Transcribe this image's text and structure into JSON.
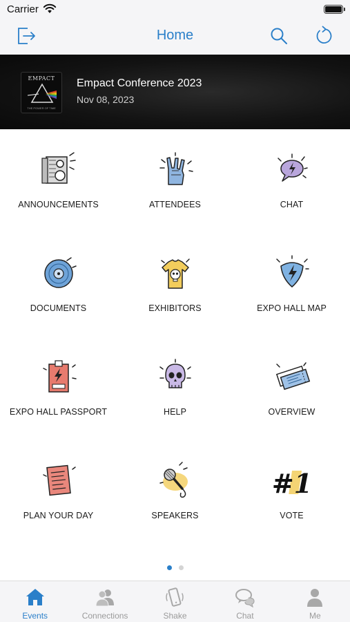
{
  "status_bar": {
    "carrier": "Carrier"
  },
  "nav": {
    "title": "Home"
  },
  "event": {
    "logo_text": "EMPACT",
    "logo_tagline": "THE POWER OF TIME",
    "title": "Empact Conference 2023",
    "date": "Nov 08, 2023"
  },
  "grid": {
    "items": [
      {
        "label": "ANNOUNCEMENTS",
        "icon": "speaker-icon"
      },
      {
        "label": "ATTENDEES",
        "icon": "rock-hand-icon"
      },
      {
        "label": "CHAT",
        "icon": "chat-bubble-icon"
      },
      {
        "label": "DOCUMENTS",
        "icon": "vinyl-record-icon"
      },
      {
        "label": "EXHIBITORS",
        "icon": "tshirt-skull-icon"
      },
      {
        "label": "EXPO HALL MAP",
        "icon": "guitar-pick-icon"
      },
      {
        "label": "EXPO HALL PASSPORT",
        "icon": "backstage-pass-icon"
      },
      {
        "label": "HELP",
        "icon": "skull-icon"
      },
      {
        "label": "OVERVIEW",
        "icon": "tickets-icon"
      },
      {
        "label": "PLAN YOUR DAY",
        "icon": "setlist-icon"
      },
      {
        "label": "SPEAKERS",
        "icon": "microphone-icon"
      },
      {
        "label": "VOTE",
        "icon": "number-one-icon"
      }
    ],
    "vote_glyph": "#1"
  },
  "pager": {
    "pages": 2,
    "current": 1
  },
  "tabs": [
    {
      "label": "Events",
      "icon": "house-icon",
      "active": true
    },
    {
      "label": "Connections",
      "icon": "people-icon",
      "active": false
    },
    {
      "label": "Shake",
      "icon": "phone-shake-icon",
      "active": false
    },
    {
      "label": "Chat",
      "icon": "chat-bubbles-icon",
      "active": false
    },
    {
      "label": "Me",
      "icon": "person-icon",
      "active": false
    }
  ],
  "colors": {
    "accent": "#2a7fc9",
    "tab_inactive": "#9a9a9a",
    "banner_bg": "#121212"
  }
}
